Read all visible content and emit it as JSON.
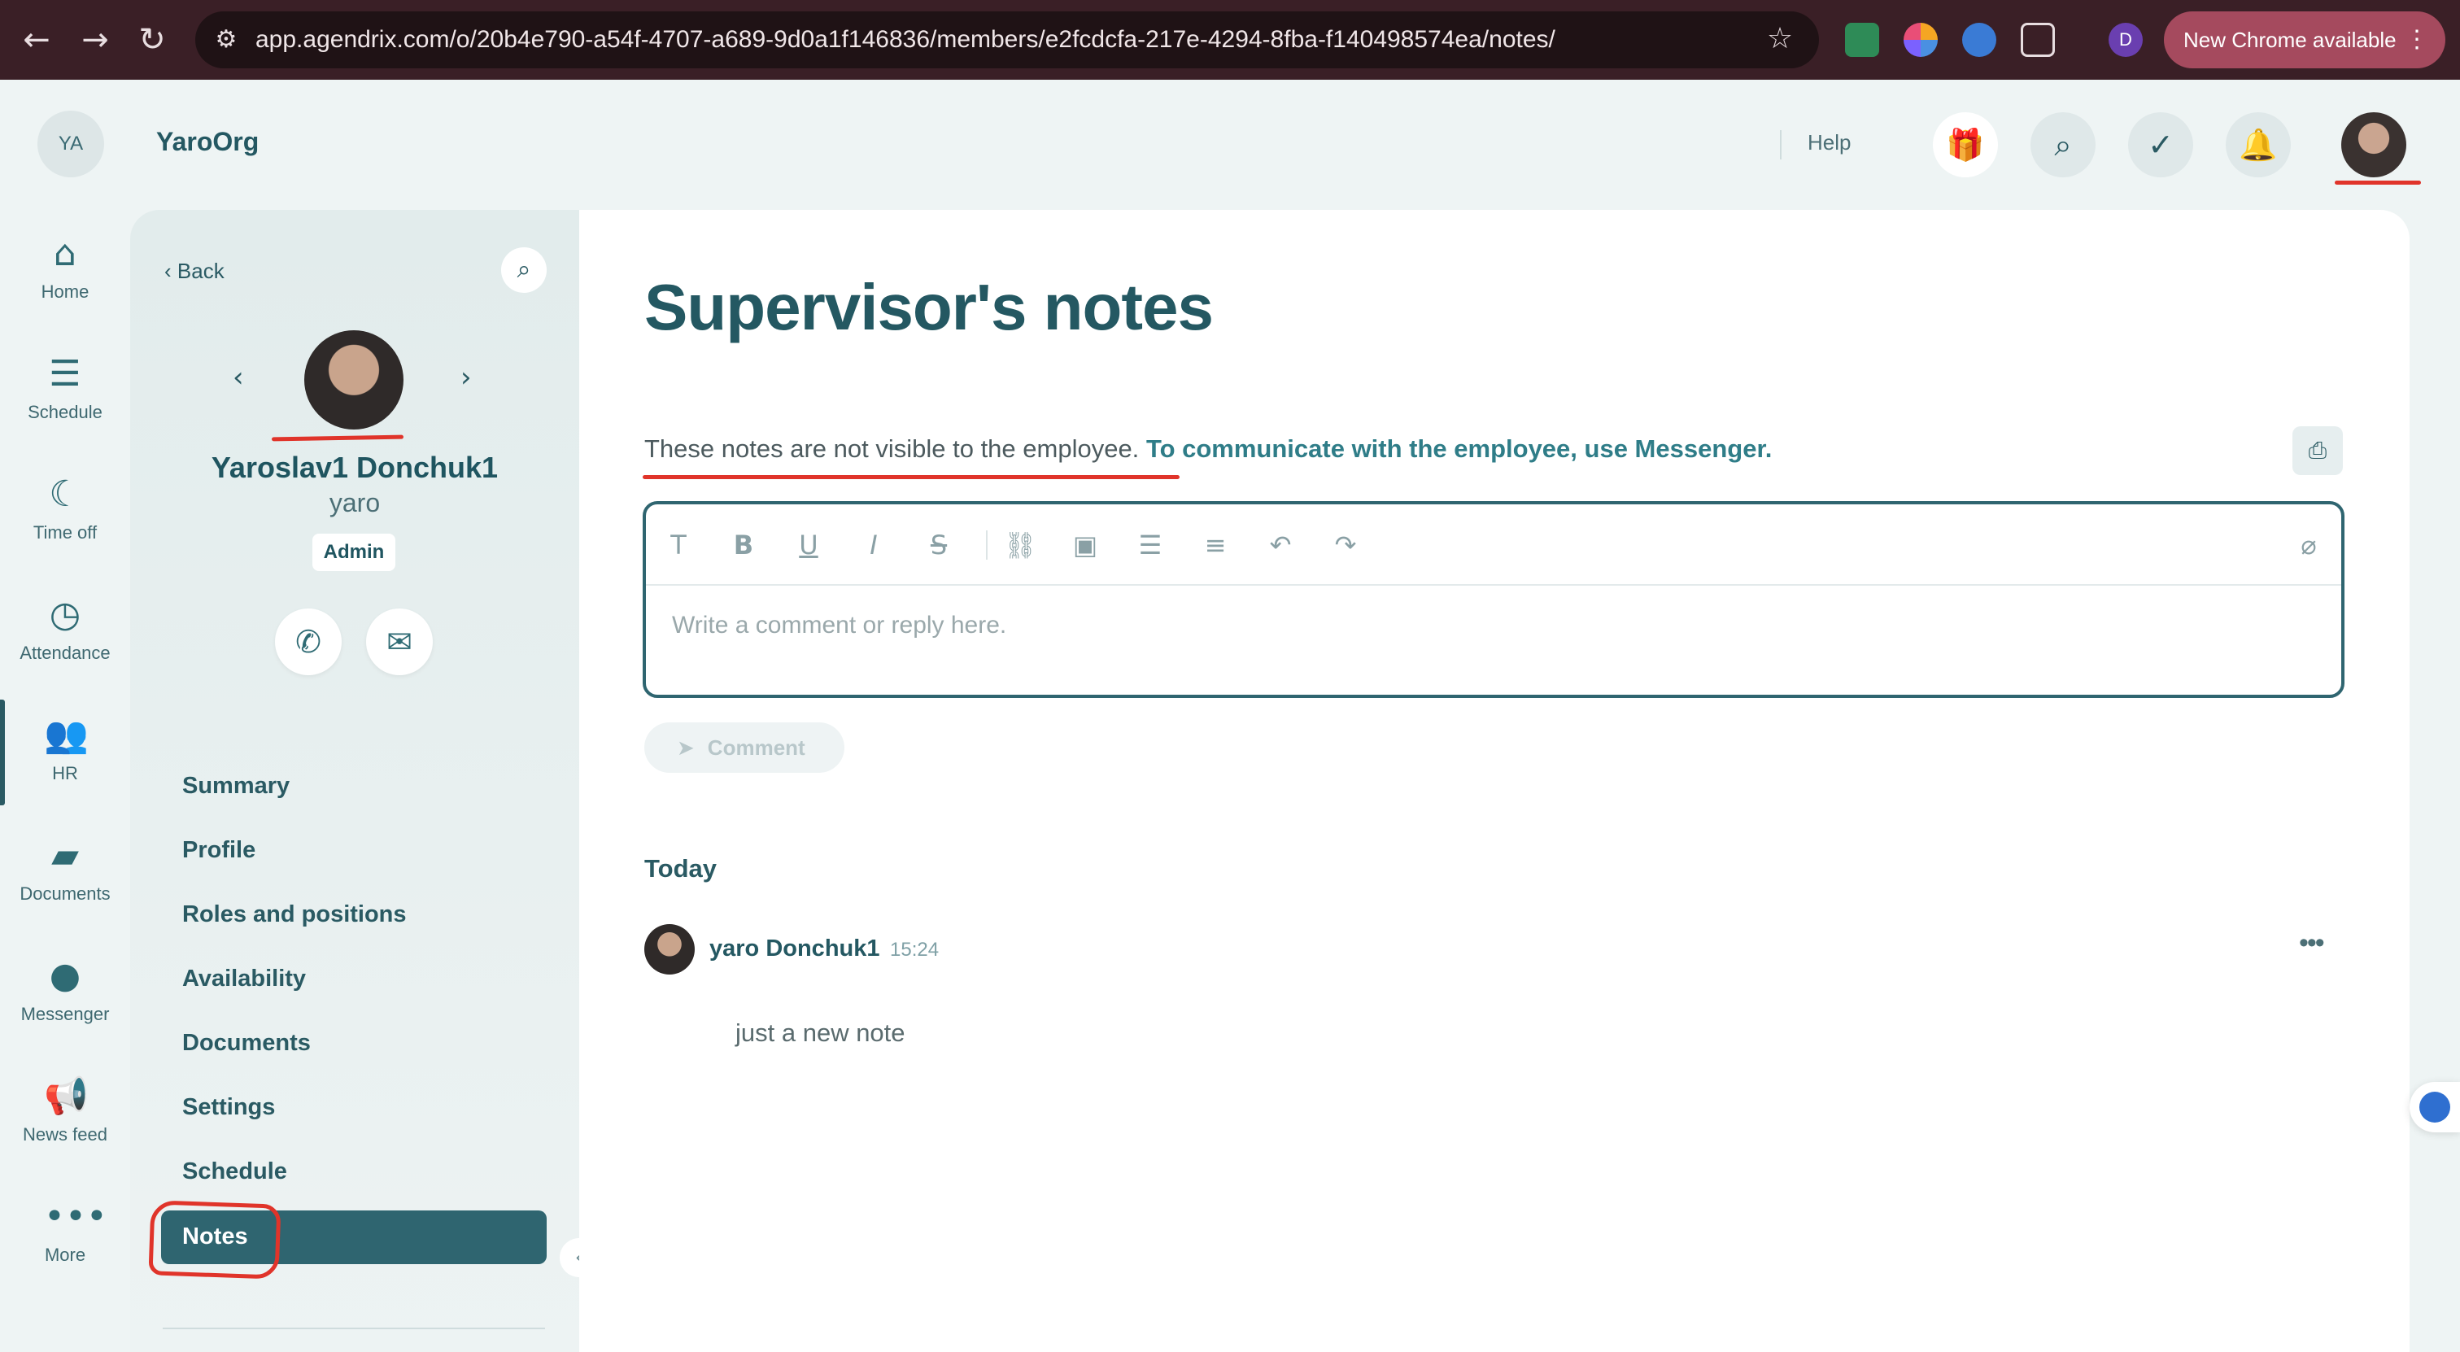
{
  "browser": {
    "url": "app.agendrix.com/o/20b4e790-a54f-4707-a689-9d0a1f146836/members/e2fcdcfa-217e-4294-8fba-f140498574ea/notes/",
    "profile_initial": "D",
    "update_label": "New Chrome available"
  },
  "header": {
    "org_initials": "YA",
    "org_name": "YaroOrg",
    "help_label": "Help"
  },
  "rail": {
    "items": [
      {
        "label": "Home",
        "icon": "home-icon"
      },
      {
        "label": "Schedule",
        "icon": "schedule-icon"
      },
      {
        "label": "Time off",
        "icon": "moon-icon"
      },
      {
        "label": "Attendance",
        "icon": "clock-icon"
      },
      {
        "label": "HR",
        "icon": "people-icon"
      },
      {
        "label": "Documents",
        "icon": "folder-icon"
      },
      {
        "label": "Messenger",
        "icon": "chat-icon"
      },
      {
        "label": "News feed",
        "icon": "megaphone-icon"
      },
      {
        "label": "More",
        "icon": "more-icon"
      }
    ],
    "active": "HR"
  },
  "profile": {
    "back_label": "Back",
    "name": "Yaroslav1 Donchuk1",
    "username": "yaro",
    "role": "Admin",
    "nav": [
      "Summary",
      "Profile",
      "Roles and positions",
      "Availability",
      "Documents",
      "Settings",
      "Schedule",
      "Notes"
    ],
    "active_nav": "Notes"
  },
  "main": {
    "title": "Supervisor's notes",
    "info_text": "These notes are not visible to the employee.",
    "info_link": "To communicate with the employee, use Messenger.",
    "editor_placeholder": "Write a comment or reply here.",
    "comment_button": "Comment",
    "day_label": "Today",
    "note": {
      "author": "yaro Donchuk1",
      "time": "15:24",
      "body": "just a new note"
    }
  },
  "colors": {
    "brand": "#2f6570",
    "annotation_red": "#e0342a"
  }
}
